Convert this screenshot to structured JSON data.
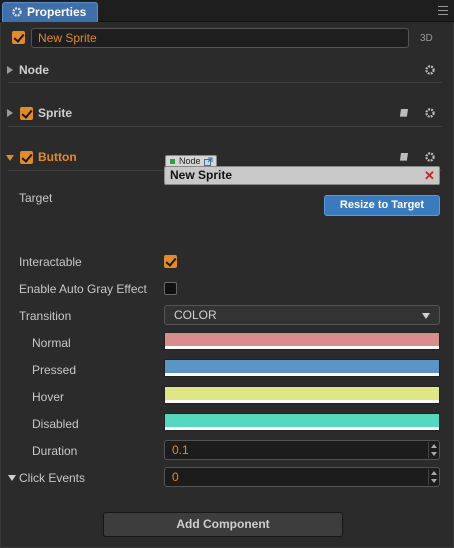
{
  "window": {
    "tab_title": "Properties",
    "tab_icon": "gear-icon",
    "menu_icon": "hamburger-menu-icon"
  },
  "node": {
    "name": "New Sprite",
    "enabled": true,
    "label_3d": "3D"
  },
  "sections": {
    "node": {
      "title": "Node",
      "expanded": false
    },
    "sprite": {
      "title": "Sprite",
      "expanded": false,
      "enabled": true
    },
    "button": {
      "title": "Button",
      "expanded": true,
      "enabled": true
    }
  },
  "button_props": {
    "target_label": "Target",
    "target_tag": "Node",
    "target_value": "New Sprite",
    "resize_label": "Resize to Target",
    "interactable_label": "Interactable",
    "interactable": true,
    "auto_gray_label": "Enable Auto Gray Effect",
    "auto_gray": false,
    "transition_label": "Transition",
    "transition_value": "COLOR",
    "normal_label": "Normal",
    "normal_color": "#d98c8c",
    "pressed_label": "Pressed",
    "pressed_color": "#5b95c8",
    "hover_label": "Hover",
    "hover_color": "#dfe685",
    "disabled_label": "Disabled",
    "disabled_color": "#55d8bd",
    "duration_label": "Duration",
    "duration_value": "0.1",
    "click_events_label": "Click Events",
    "click_events_value": "0"
  },
  "footer": {
    "add_component_label": "Add Component"
  },
  "colors": {
    "accent": "#e08a2b",
    "tab_blue": "#3f6fa8",
    "button_blue": "#3a7bbf",
    "panel_bg": "#2b2b2b"
  }
}
